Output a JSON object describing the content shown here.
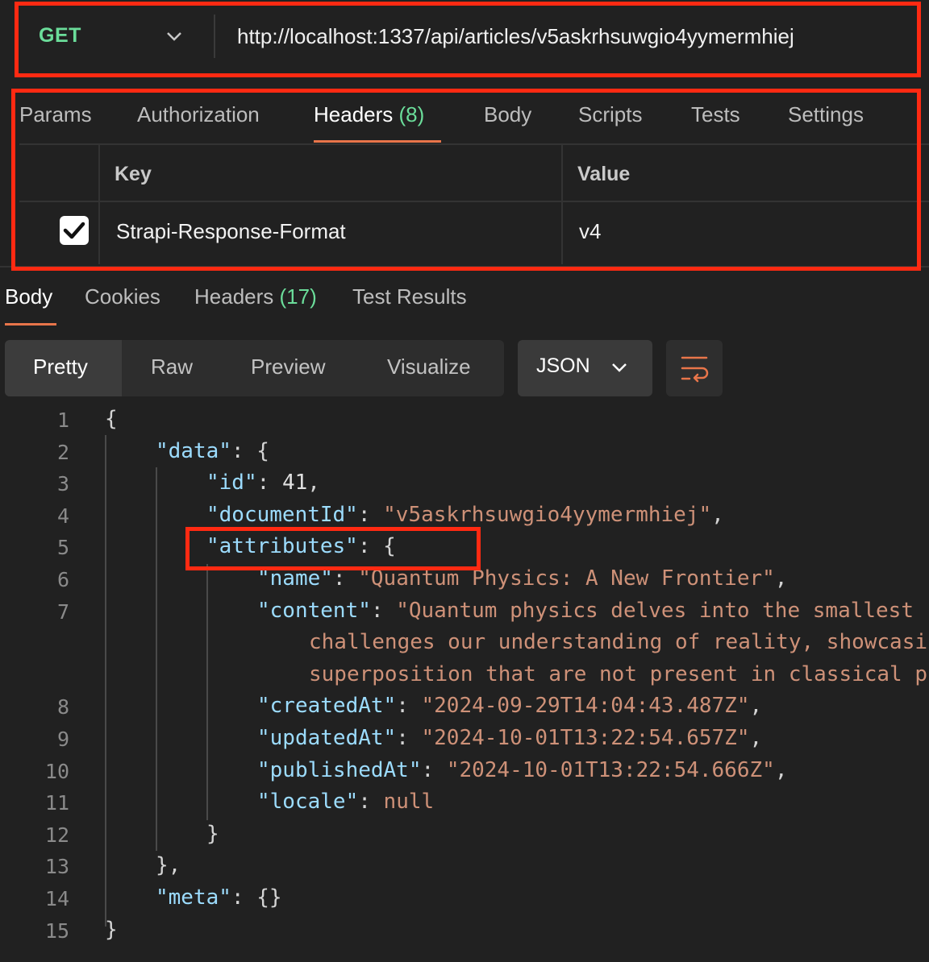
{
  "request": {
    "method": "GET",
    "url": "http://localhost:1337/api/articles/v5askrhsuwgio4yymermhiej"
  },
  "request_tabs": {
    "params": "Params",
    "authorization": "Authorization",
    "headers": "Headers",
    "headers_count": "(8)",
    "body": "Body",
    "scripts": "Scripts",
    "tests": "Tests",
    "settings": "Settings"
  },
  "headers_table": {
    "key_header": "Key",
    "value_header": "Value",
    "rows": [
      {
        "checked": true,
        "key": "Strapi-Response-Format",
        "value": "v4"
      }
    ]
  },
  "response_tabs": {
    "body": "Body",
    "cookies": "Cookies",
    "headers": "Headers",
    "headers_count": "(17)",
    "test_results": "Test Results"
  },
  "view_modes": {
    "pretty": "Pretty",
    "raw": "Raw",
    "preview": "Preview",
    "visualize": "Visualize",
    "format": "JSON"
  },
  "line_numbers": [
    "1",
    "2",
    "3",
    "4",
    "5",
    "6",
    "7",
    "8",
    "9",
    "10",
    "11",
    "12",
    "13",
    "14",
    "15"
  ],
  "code": {
    "open_brace": "{",
    "close_brace": "}",
    "data_key": "\"data\"",
    "id_key": "\"id\"",
    "id_val": "41",
    "docid_key": "\"documentId\"",
    "docid_val": "\"v5askrhsuwgio4yymermhiej\"",
    "attributes_key": "\"attributes\"",
    "name_key": "\"name\"",
    "name_val": "\"Quantum Physics: A New Frontier\"",
    "content_key": "\"content\"",
    "content_line1": "\"Quantum physics delves into the smallest",
    "content_line2": "challenges our understanding of reality, showcasi",
    "content_line3": "superposition that are not present in classical p",
    "createdAt_key": "\"createdAt\"",
    "createdAt_val": "\"2024-09-29T14:04:43.487Z\"",
    "updatedAt_key": "\"updatedAt\"",
    "updatedAt_val": "\"2024-10-01T13:22:54.657Z\"",
    "publishedAt_key": "\"publishedAt\"",
    "publishedAt_val": "\"2024-10-01T13:22:54.666Z\"",
    "locale_key": "\"locale\"",
    "locale_val": "null",
    "meta_key": "\"meta\"",
    "meta_val": "{}"
  },
  "colors": {
    "accent": "#e8754a",
    "method_get": "#6bdd9a",
    "highlight_box": "#ff2a12",
    "json_key": "#9cdcfe",
    "json_string": "#ce9178"
  }
}
